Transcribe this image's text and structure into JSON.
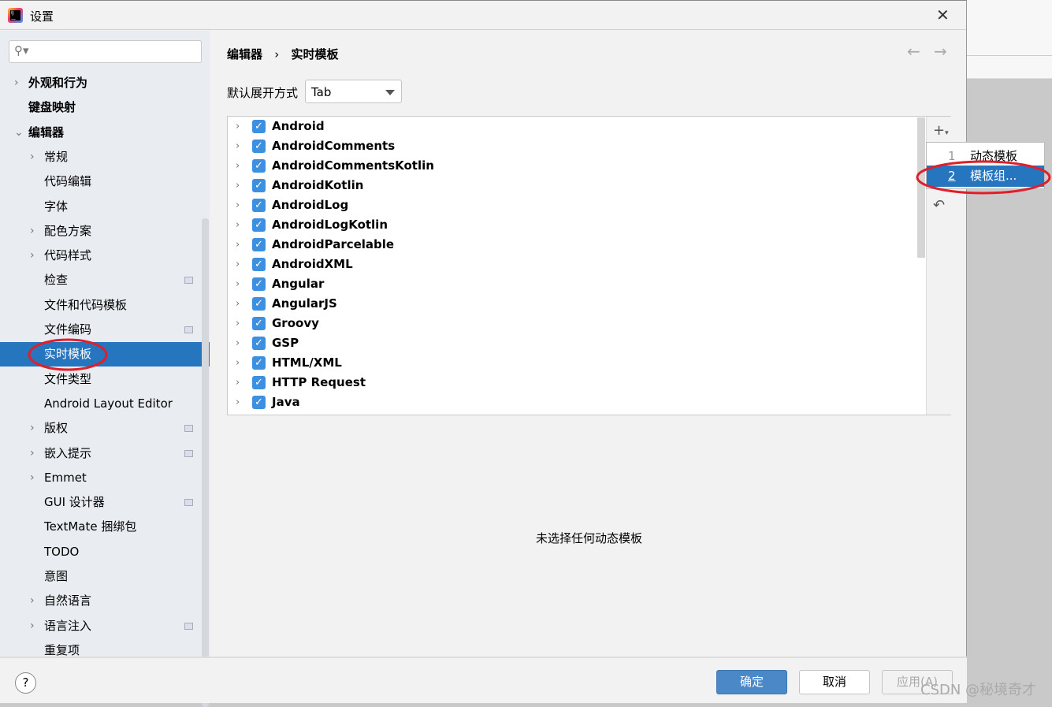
{
  "window": {
    "title": "设置",
    "close": "✕"
  },
  "search": {
    "placeholder": "",
    "icon": "search-icon"
  },
  "sidebar": {
    "items": [
      {
        "label": "外观和行为",
        "bold": true,
        "arrow": "›",
        "level": 0
      },
      {
        "label": "键盘映射",
        "bold": true,
        "arrow": "",
        "level": 0
      },
      {
        "label": "编辑器",
        "bold": true,
        "arrow": "⌄",
        "level": 0
      },
      {
        "label": "常规",
        "arrow": "›",
        "level": 1
      },
      {
        "label": "代码编辑",
        "arrow": "",
        "level": 1
      },
      {
        "label": "字体",
        "arrow": "",
        "level": 1
      },
      {
        "label": "配色方案",
        "arrow": "›",
        "level": 1
      },
      {
        "label": "代码样式",
        "arrow": "›",
        "level": 1
      },
      {
        "label": "检查",
        "arrow": "",
        "level": 1,
        "badge": true
      },
      {
        "label": "文件和代码模板",
        "arrow": "",
        "level": 1
      },
      {
        "label": "文件编码",
        "arrow": "",
        "level": 1,
        "badge": true
      },
      {
        "label": "实时模板",
        "arrow": "",
        "level": 1,
        "selected": true
      },
      {
        "label": "文件类型",
        "arrow": "",
        "level": 1
      },
      {
        "label": "Android Layout Editor",
        "arrow": "",
        "level": 1
      },
      {
        "label": "版权",
        "arrow": "›",
        "level": 1,
        "badge": true
      },
      {
        "label": "嵌入提示",
        "arrow": "›",
        "level": 1,
        "badge": true
      },
      {
        "label": "Emmet",
        "arrow": "›",
        "level": 1
      },
      {
        "label": "GUI 设计器",
        "arrow": "",
        "level": 1,
        "badge": true
      },
      {
        "label": "TextMate 捆绑包",
        "arrow": "",
        "level": 1
      },
      {
        "label": "TODO",
        "arrow": "",
        "level": 1
      },
      {
        "label": "意图",
        "arrow": "",
        "level": 1
      },
      {
        "label": "自然语言",
        "arrow": "›",
        "level": 1
      },
      {
        "label": "语言注入",
        "arrow": "›",
        "level": 1,
        "badge": true
      },
      {
        "label": "重复项",
        "arrow": "",
        "level": 1
      }
    ]
  },
  "breadcrumb": {
    "parent": "编辑器",
    "sep": "›",
    "current": "实时模板"
  },
  "expand": {
    "label": "默认展开方式",
    "value": "Tab"
  },
  "templates": [
    "Android",
    "AndroidComments",
    "AndroidCommentsKotlin",
    "AndroidKotlin",
    "AndroidLog",
    "AndroidLogKotlin",
    "AndroidParcelable",
    "AndroidXML",
    "Angular",
    "AngularJS",
    "Groovy",
    "GSP",
    "HTML/XML",
    "HTTP Request",
    "Java"
  ],
  "popup": {
    "items": [
      {
        "num": "1",
        "label": "动态模板"
      },
      {
        "num": "2",
        "label": "模板组...",
        "selected": true
      }
    ]
  },
  "empty_text": "未选择任何动态模板",
  "buttons": {
    "ok": "确定",
    "cancel": "取消",
    "apply": "应用(A)",
    "help": "?"
  },
  "watermark": "CSDN @秘境奇才",
  "colors": {
    "accent": "#2675bf",
    "checkbox": "#3d8fe0",
    "annotation": "#e01f2a"
  }
}
